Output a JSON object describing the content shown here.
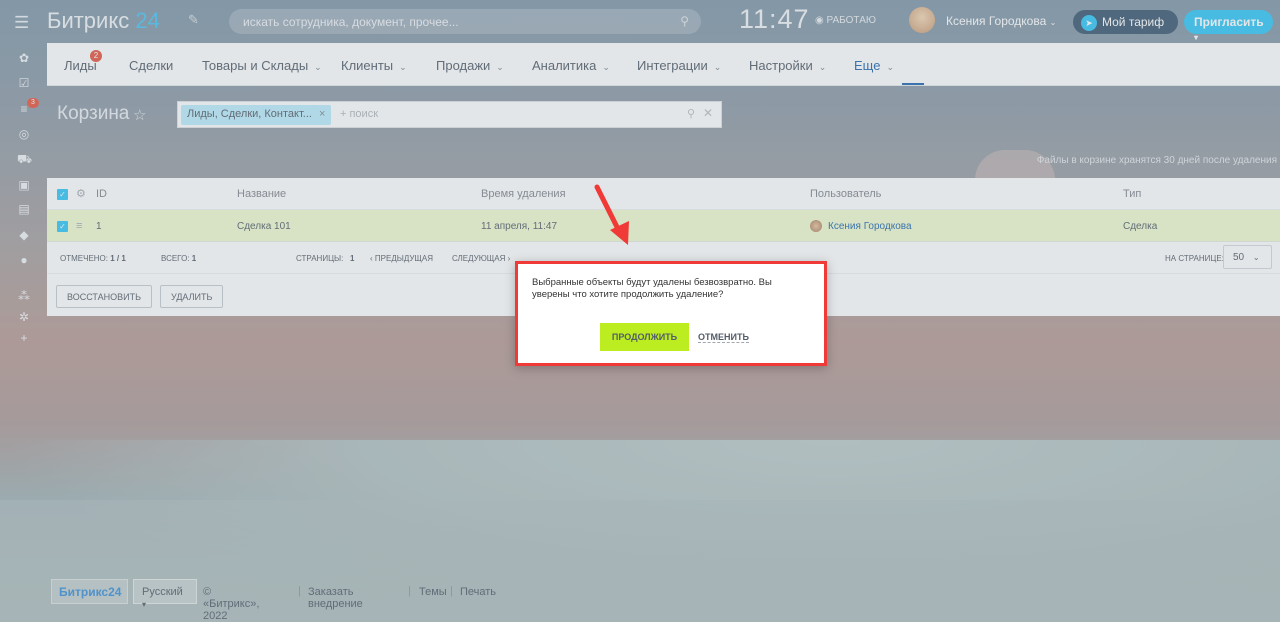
{
  "header": {
    "logo_text": "Битрикс",
    "logo_num": "24",
    "search_placeholder": "искать сотрудника, документ, прочее...",
    "clock": "11:47",
    "status": "РАБОТАЮ",
    "user_name": "Ксения Городкова",
    "tariff_label": "Мой тариф",
    "invite_label": "Пригласить"
  },
  "nav": {
    "items": [
      {
        "label": "Лиды",
        "badge": "2"
      },
      {
        "label": "Сделки"
      },
      {
        "label": "Товары и Склады"
      },
      {
        "label": "Клиенты"
      },
      {
        "label": "Продажи"
      },
      {
        "label": "Аналитика"
      },
      {
        "label": "Интеграции"
      },
      {
        "label": "Настройки"
      },
      {
        "label": "Еще"
      }
    ]
  },
  "sidebar": {
    "badge": "3"
  },
  "page": {
    "title": "Корзина",
    "filter_tag": "Лиды, Сделки, Контакт...",
    "filter_placeholder": "+ поиск",
    "note": "Файлы в корзине хранятся 30 дней после удаления"
  },
  "grid": {
    "columns": [
      "ID",
      "Название",
      "Время удаления",
      "Пользователь",
      "Тип"
    ],
    "rows": [
      {
        "id": "1",
        "name": "Сделка 101",
        "deleted": "11 апреля, 11:47",
        "user": "Ксения Городкова",
        "type": "Сделка"
      }
    ],
    "footer": {
      "selected_label": "ОТМЕЧЕНО:",
      "selected_value": "1 / 1",
      "total_label": "ВСЕГО:",
      "total_value": "1",
      "pages_label": "СТРАНИЦЫ:",
      "pages_value": "1",
      "prev": "ПРЕДЫДУЩАЯ",
      "next": "СЛЕДУЮЩАЯ",
      "per_page_label": "НА СТРАНИЦЕ:",
      "per_page_value": "50"
    },
    "restore_label": "ВОССТАНОВИТЬ",
    "delete_label": "УДАЛИТЬ"
  },
  "dialog": {
    "message": "Выбранные объекты будут удалены безвозвратно. Вы уверены что хотите продолжить удаление?",
    "continue_label": "ПРОДОЛЖИТЬ",
    "cancel_label": "ОТМЕНИТЬ"
  },
  "footer": {
    "logo": "Битрикс24",
    "language": "Русский",
    "copyright": "© «Битрикс», 2022",
    "links": [
      "Заказать внедрение",
      "Темы",
      "Печать"
    ]
  },
  "colors": {
    "accent": "#2fc6f6",
    "continue_button": "#bbed21",
    "highlight_frame": "#f03a37",
    "badge": "#e5553e"
  }
}
